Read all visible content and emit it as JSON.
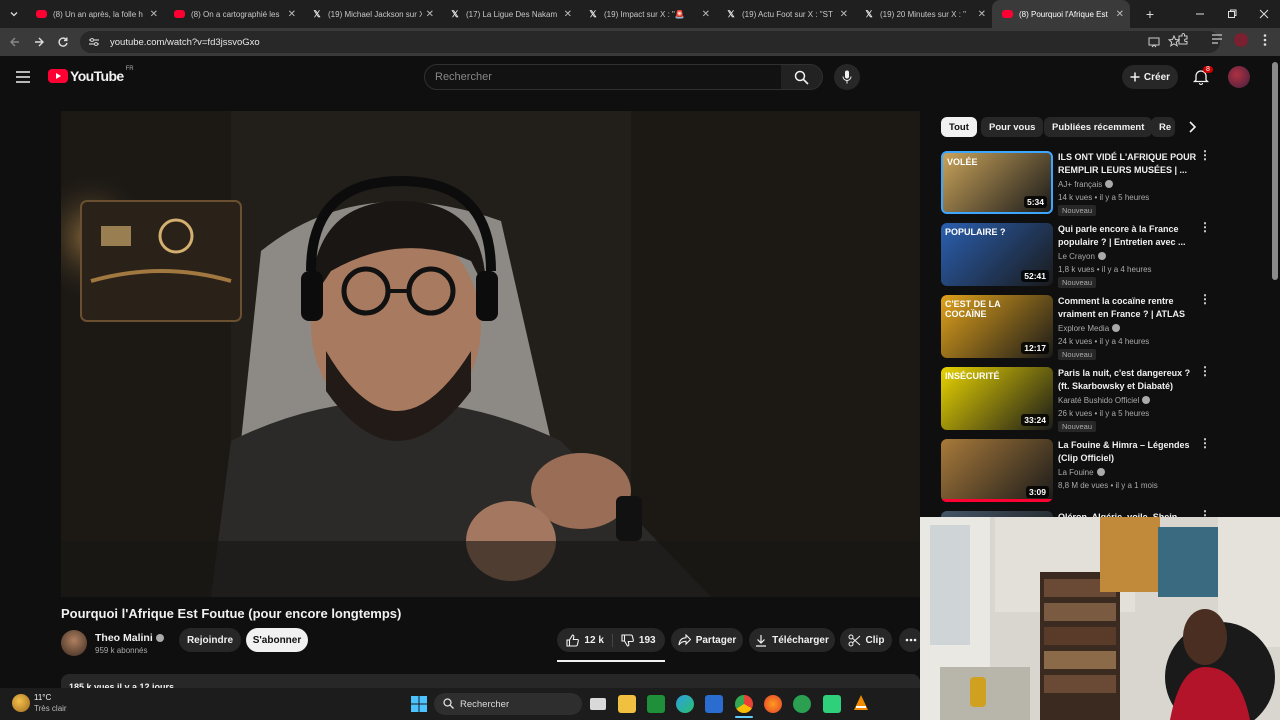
{
  "browser": {
    "tabs": [
      {
        "title": "(8) Un an après, la folle h",
        "favicon": "youtube-icon"
      },
      {
        "title": "(8) On a cartographié les",
        "favicon": "youtube-icon"
      },
      {
        "title": "(19) Michael Jackson sur X",
        "favicon": "x-icon"
      },
      {
        "title": "(17) La Ligue Des Nakam",
        "favicon": "x-icon"
      },
      {
        "title": "(19) Impact sur X : \"🚨",
        "favicon": "x-icon"
      },
      {
        "title": "(19) Actu Foot sur X : \"ST",
        "favicon": "x-icon"
      },
      {
        "title": "(19) 20 Minutes sur X : \"",
        "favicon": "x-icon"
      },
      {
        "title": "(8) Pourquoi l'Afrique Est",
        "favicon": "youtube-icon",
        "active": true
      }
    ],
    "url": "youtube.com/watch?v=fd3jssvoGxo"
  },
  "masthead": {
    "logo_text": "YouTube",
    "country_code": "FR",
    "search_placeholder": "Rechercher",
    "create_label": "Créer",
    "notification_count": "8"
  },
  "video": {
    "title": "Pourquoi l'Afrique Est Foutue (pour encore longtemps)",
    "channel": "Theo Malini",
    "subscribers": "959 k abonnés",
    "join_label": "Rejoindre",
    "subscribe_label": "S'abonner",
    "likes": "12 k",
    "dislikes": "193",
    "share_label": "Partager",
    "download_label": "Télécharger",
    "clip_label": "Clip",
    "description_peek": "185 k vues  il y a 12 jours"
  },
  "chips": [
    "Tout",
    "Pour vous",
    "Publiées récemment",
    "Re"
  ],
  "suggestions": [
    {
      "title": "ILS ONT VIDÉ L'AFRIQUE POUR REMPLIR LEURS MUSÉES | ...",
      "channel": "AJ+ français",
      "meta": "14 k vues • il y a 5 heures",
      "badge": "Nouveau",
      "duration": "5:34",
      "thumb_text": "VOLÉE",
      "accent": "#c9a35a"
    },
    {
      "title": "Qui parle encore à la France populaire ? | Entretien avec ...",
      "channel": "Le Crayon",
      "meta": "1,8 k vues • il y a 4 heures",
      "badge": "Nouveau",
      "duration": "52:41",
      "thumb_text": "POPULAIRE ?",
      "accent": "#2a5fb0"
    },
    {
      "title": "Comment la cocaïne rentre vraiment en France ? | ATLAS",
      "channel": "Explore Media",
      "meta": "24 k vues • il y a 4 heures",
      "badge": "Nouveau",
      "duration": "12:17",
      "thumb_text": "C'EST DE LA COCAÏNE",
      "accent": "#e0a21b"
    },
    {
      "title": "Paris la nuit, c'est dangereux ? (ft. Skarbowsky et Diabaté)",
      "channel": "Karaté Bushido Officiel",
      "meta": "26 k vues • il y a 5 heures",
      "badge": "Nouveau",
      "duration": "33:24",
      "thumb_text": "INSÉCURITÉ",
      "accent": "#e8d400"
    },
    {
      "title": "La Fouine & Himra – Légendes (Clip Officiel)",
      "channel": "La Fouine",
      "meta": "8,8 M de vues • il y a 1 mois",
      "badge": "",
      "duration": "3:09",
      "thumb_text": "",
      "accent": "#a87a3a"
    },
    {
      "title": "Oléron, Algérie, voile, Shein...",
      "channel": "",
      "meta": "",
      "badge": "",
      "duration": "",
      "thumb_text": "",
      "accent": "#445566"
    }
  ],
  "taskbar": {
    "weather_temp": "11°C",
    "weather_desc": "Très clair",
    "search_label": "Rechercher"
  }
}
